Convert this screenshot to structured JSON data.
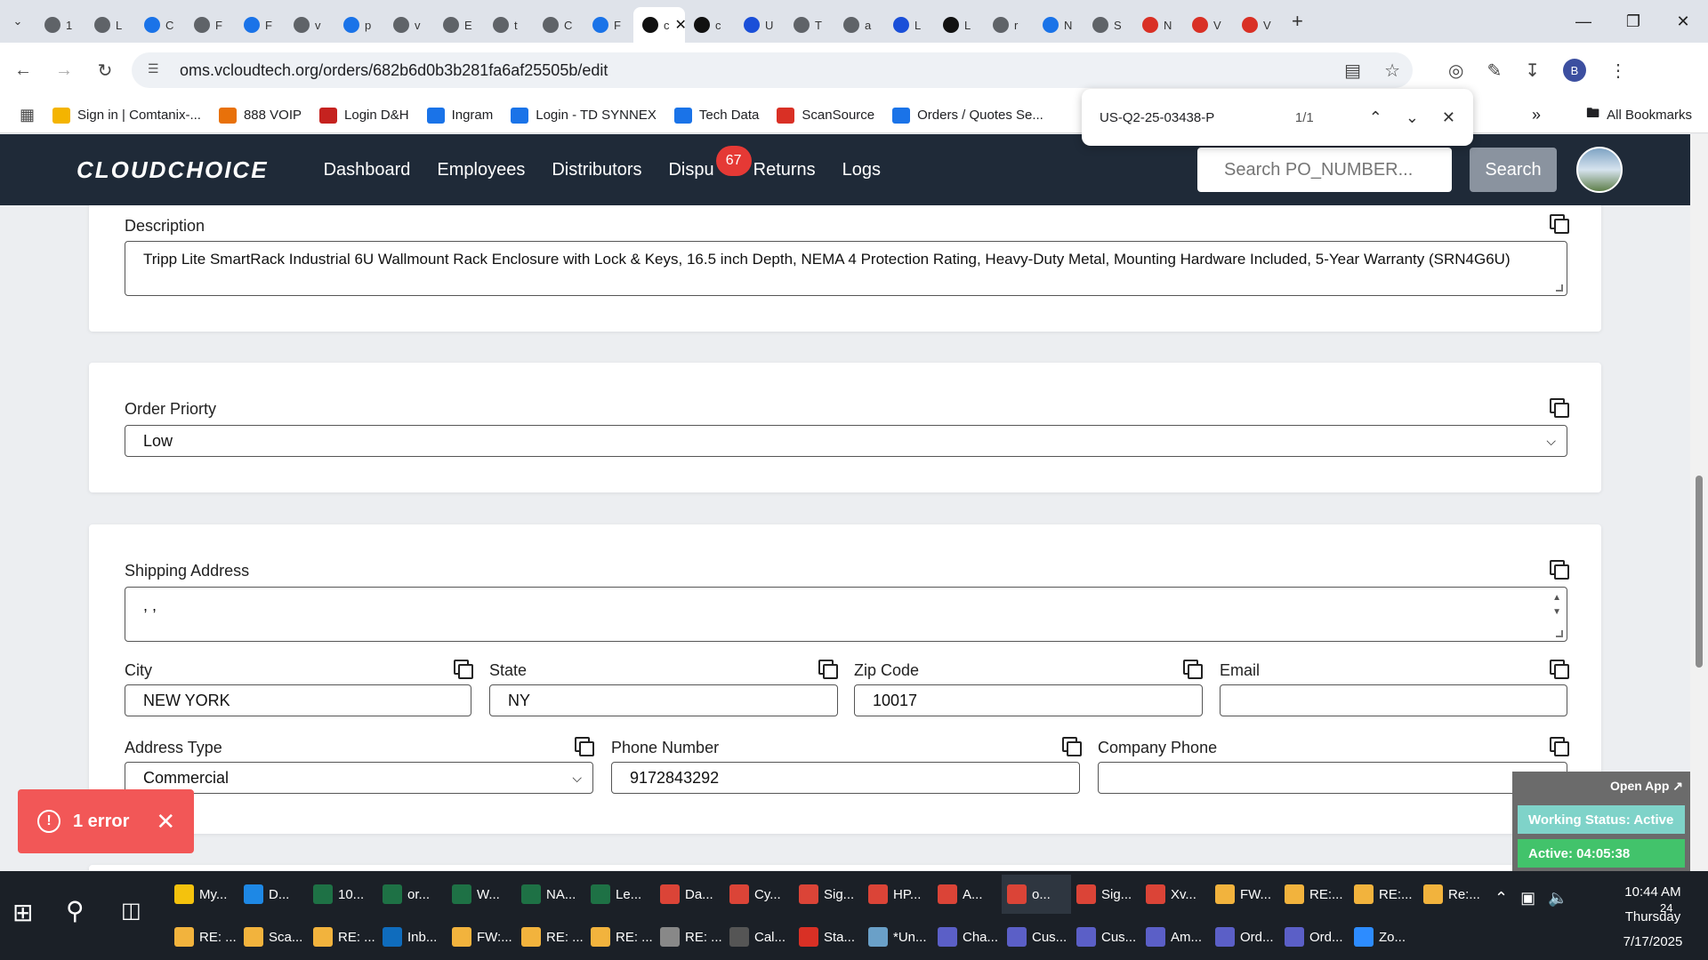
{
  "browser": {
    "tabs": [
      {
        "icon": "globe-icon",
        "label": "1",
        "color": "#5f6368"
      },
      {
        "icon": "globe-icon",
        "label": "L",
        "color": "#5f6368"
      },
      {
        "icon": "ingram-icon",
        "label": "C",
        "color": "#1a73e8"
      },
      {
        "icon": "globe-icon",
        "label": "F",
        "color": "#5f6368"
      },
      {
        "icon": "arrow-icon",
        "label": "F",
        "color": "#1a73e8"
      },
      {
        "icon": "globe-icon",
        "label": "v",
        "color": "#5f6368"
      },
      {
        "icon": "jira-icon",
        "label": "p",
        "color": "#1a73e8"
      },
      {
        "icon": "globe-icon",
        "label": "v",
        "color": "#5f6368"
      },
      {
        "icon": "globe-icon",
        "label": "E",
        "color": "#5f6368"
      },
      {
        "icon": "globe-icon",
        "label": "t",
        "color": "#5f6368"
      },
      {
        "icon": "globe-icon",
        "label": "C",
        "color": "#5f6368"
      },
      {
        "icon": "cloud-icon",
        "label": "F",
        "color": "#1a73e8"
      },
      {
        "icon": "circle-icon",
        "label": "c",
        "color": "#111111",
        "active": true
      },
      {
        "icon": "avatar-icon",
        "label": "c",
        "color": "#111111"
      },
      {
        "icon": "u-icon",
        "label": "U",
        "color": "#1a4fd8"
      },
      {
        "icon": "globe-icon",
        "label": "T",
        "color": "#5f6368"
      },
      {
        "icon": "globe-icon",
        "label": "a",
        "color": "#5f6368"
      },
      {
        "icon": "square-icon",
        "label": "L",
        "color": "#1a4fd8"
      },
      {
        "icon": "check-icon",
        "label": "L",
        "color": "#111111"
      },
      {
        "icon": "globe-icon",
        "label": "r",
        "color": "#5f6368"
      },
      {
        "icon": "etn-icon",
        "label": "N",
        "color": "#1a73e8"
      },
      {
        "icon": "globe-icon",
        "label": "S",
        "color": "#5f6368"
      },
      {
        "icon": "shield-icon",
        "label": "N",
        "color": "#d93025"
      },
      {
        "icon": "shield-icon",
        "label": "V",
        "color": "#d93025"
      },
      {
        "icon": "shield-icon",
        "label": "V",
        "color": "#d93025"
      }
    ],
    "url": "oms.vcloudtech.org/orders/682b6d0b3b281fa6af25505b/edit",
    "profile_initial": "B",
    "bookmarks": [
      {
        "label": "Sign in | Comtanix-...",
        "color": "#f4b400",
        "icon": "w-icon"
      },
      {
        "label": "888 VOIP",
        "color": "#e8710a",
        "icon": "voip-icon"
      },
      {
        "label": "Login D&H",
        "color": "#c5221f",
        "icon": "dh-icon"
      },
      {
        "label": "Ingram",
        "color": "#1a73e8",
        "icon": "ingram-icon"
      },
      {
        "label": "Login - TD SYNNEX",
        "color": "#1a73e8",
        "icon": "synnex-icon"
      },
      {
        "label": "Tech Data",
        "color": "#1a73e8",
        "icon": "techdata-icon"
      },
      {
        "label": "ScanSource",
        "color": "#d93025",
        "icon": "scansource-icon"
      },
      {
        "label": "Orders / Quotes Se...",
        "color": "#1a73e8",
        "icon": "orders-icon"
      }
    ],
    "all_bookmarks": "All Bookmarks"
  },
  "find": {
    "query": "US-Q2-25-03438-P",
    "count": "1/1"
  },
  "app": {
    "logo": "CLOUDCHOICE",
    "nav": [
      "Dashboard",
      "Employees",
      "Distributors",
      "Dispu",
      "Returns",
      "Logs"
    ],
    "disputes_badge": "67",
    "search_placeholder": "Search PO_NUMBER...",
    "search_button": "Search"
  },
  "form": {
    "description_label": "Description",
    "description_value": "Tripp Lite SmartRack Industrial 6U Wallmount Rack Enclosure with Lock & Keys, 16.5 inch Depth, NEMA 4 Protection Rating, Heavy-Duty Metal, Mounting Hardware Included, 5-Year Warranty (SRN4G6U)",
    "priority_label": "Order Priorty",
    "priority_value": "Low",
    "shipping_label": "Shipping Address",
    "shipping_value": ", ,",
    "city_label": "City",
    "city_value": "NEW YORK",
    "state_label": "State",
    "state_value": "NY",
    "zip_label": "Zip Code",
    "zip_value": "10017",
    "email_label": "Email",
    "email_value": "",
    "address_type_label": "Address Type",
    "address_type_value": "Commercial",
    "phone_label": "Phone Number",
    "phone_value": "9172843292",
    "company_phone_label": "Company Phone",
    "company_phone_value": ""
  },
  "toast": {
    "text": "1 error"
  },
  "widget": {
    "open_app": "Open App ↗",
    "working_status": "Working Status: Active",
    "active_time": "Active: 04:05:38"
  },
  "taskbar": {
    "row1": [
      {
        "label": "My...",
        "color": "#f4c20d",
        "icon": "folder-icon"
      },
      {
        "label": "D...",
        "color": "#1e88e5",
        "icon": "edge-icon"
      },
      {
        "label": "10...",
        "color": "#1e7145",
        "icon": "excel-icon"
      },
      {
        "label": "or...",
        "color": "#1e7145",
        "icon": "excel-icon"
      },
      {
        "label": "W...",
        "color": "#1e7145",
        "icon": "excel-icon"
      },
      {
        "label": "NA...",
        "color": "#1e7145",
        "icon": "excel-icon"
      },
      {
        "label": "Le...",
        "color": "#1e7145",
        "icon": "excel-icon"
      },
      {
        "label": "Da...",
        "color": "#db4437",
        "icon": "chrome-icon"
      },
      {
        "label": "Cy...",
        "color": "#db4437",
        "icon": "chrome-icon"
      },
      {
        "label": "Sig...",
        "color": "#db4437",
        "icon": "chrome-icon"
      },
      {
        "label": "HP...",
        "color": "#db4437",
        "icon": "chrome-icon"
      },
      {
        "label": "A...",
        "color": "#db4437",
        "icon": "chrome-icon"
      },
      {
        "label": "o...",
        "color": "#db4437",
        "icon": "chrome-icon",
        "active": true
      },
      {
        "label": "Sig...",
        "color": "#db4437",
        "icon": "chrome-icon"
      },
      {
        "label": "Xv...",
        "color": "#db4437",
        "icon": "chrome-icon"
      },
      {
        "label": "FW...",
        "color": "#f2b33d",
        "icon": "mail-icon"
      },
      {
        "label": "RE:...",
        "color": "#f2b33d",
        "icon": "mail-icon"
      },
      {
        "label": "RE:...",
        "color": "#f2b33d",
        "icon": "mail-icon"
      },
      {
        "label": "Re:...",
        "color": "#f2b33d",
        "icon": "mail-icon"
      }
    ],
    "row2": [
      {
        "label": "RE: ...",
        "color": "#f2b33d",
        "icon": "mail-icon"
      },
      {
        "label": "Sca...",
        "color": "#f2b33d",
        "icon": "mail-icon"
      },
      {
        "label": "RE: ...",
        "color": "#f2b33d",
        "icon": "mail-icon"
      },
      {
        "label": "Inb...",
        "color": "#0f6cbd",
        "icon": "outlook-icon"
      },
      {
        "label": "FW:...",
        "color": "#f2b33d",
        "icon": "mail-icon"
      },
      {
        "label": "RE: ...",
        "color": "#f2b33d",
        "icon": "mail-icon"
      },
      {
        "label": "RE: ...",
        "color": "#f2b33d",
        "icon": "mail-icon"
      },
      {
        "label": "RE: ...",
        "color": "#888888",
        "icon": "mail-icon"
      },
      {
        "label": "Cal...",
        "color": "#555555",
        "icon": "calculator-icon"
      },
      {
        "label": "Sta...",
        "color": "#d93025",
        "icon": "pdf-icon"
      },
      {
        "label": "*Un...",
        "color": "#6aa0c8",
        "icon": "notepad-icon"
      },
      {
        "label": "Cha...",
        "color": "#5b5fc7",
        "icon": "teams-icon"
      },
      {
        "label": "Cus...",
        "color": "#5b5fc7",
        "icon": "teams-icon"
      },
      {
        "label": "Cus...",
        "color": "#5b5fc7",
        "icon": "teams-icon"
      },
      {
        "label": "Am...",
        "color": "#5b5fc7",
        "icon": "teams-icon"
      },
      {
        "label": "Ord...",
        "color": "#5b5fc7",
        "icon": "teams-icon"
      },
      {
        "label": "Ord...",
        "color": "#5b5fc7",
        "icon": "teams-icon"
      },
      {
        "label": "Zo...",
        "color": "#2d8cff",
        "icon": "zoom-icon"
      }
    ],
    "time": "10:44 AM",
    "day": "Thursday",
    "date": "7/17/2025",
    "notifications": "24"
  }
}
